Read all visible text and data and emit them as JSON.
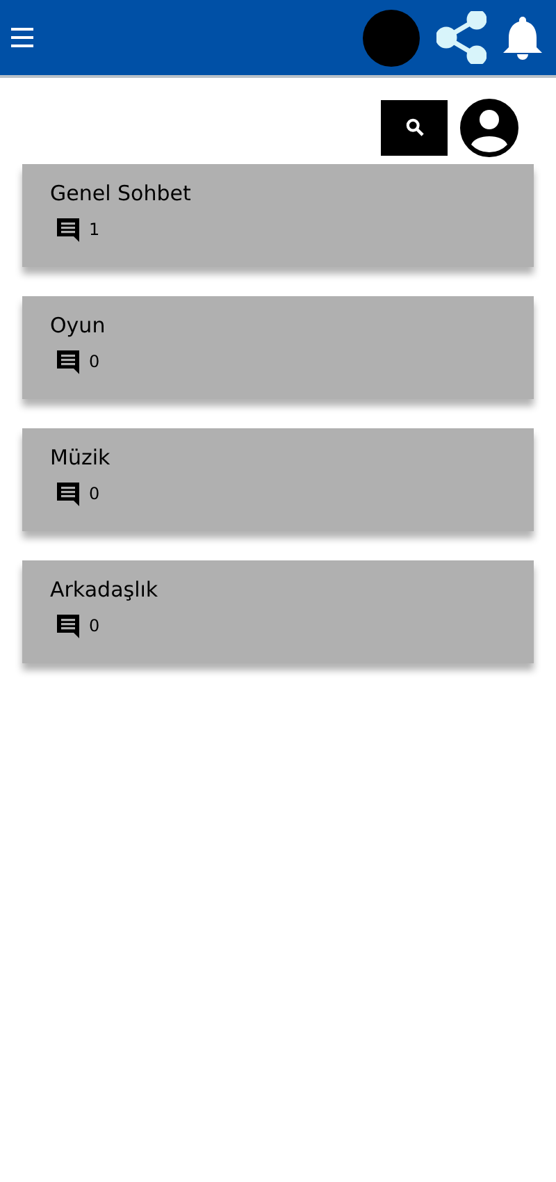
{
  "forums": [
    {
      "title": "Genel Sohbet",
      "count": "1"
    },
    {
      "title": "Oyun",
      "count": "0"
    },
    {
      "title": "Müzik",
      "count": "0"
    },
    {
      "title": "Arkadaşlık",
      "count": "0"
    }
  ]
}
